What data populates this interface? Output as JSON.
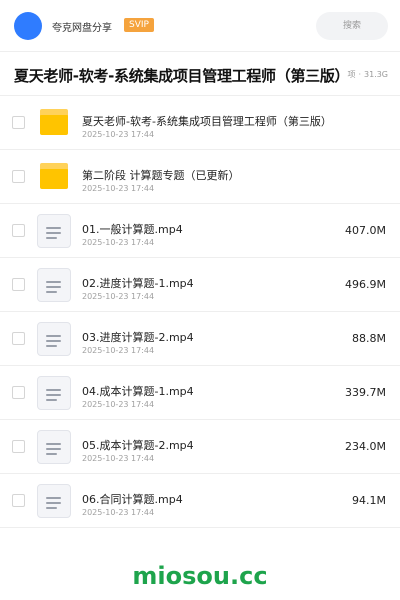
{
  "header": {
    "share_name": "夸克网盘分享",
    "badge": "SVIP",
    "search_placeholder": "搜索"
  },
  "title_row": {
    "title": "夏天老师-软考-系统集成项目管理工程师（第三版）",
    "meta_left": "项",
    "meta_size": "31.3G"
  },
  "items": [
    {
      "type": "folder",
      "name": "夏天老师-软考-系统集成项目管理工程师（第三版）",
      "date": "2025-10-23 17:44",
      "size": ""
    },
    {
      "type": "folder",
      "name": "第二阶段 计算题专题（已更新）",
      "date": "2025-10-23 17:44",
      "size": ""
    },
    {
      "type": "file",
      "name": "01.一般计算题.mp4",
      "date": "2025-10-23 17:44",
      "size": "407.0M"
    },
    {
      "type": "file",
      "name": "02.进度计算题-1.mp4",
      "date": "2025-10-23 17:44",
      "size": "496.9M"
    },
    {
      "type": "file",
      "name": "03.进度计算题-2.mp4",
      "date": "2025-10-23 17:44",
      "size": "88.8M"
    },
    {
      "type": "file",
      "name": "04.成本计算题-1.mp4",
      "date": "2025-10-23 17:44",
      "size": "339.7M"
    },
    {
      "type": "file",
      "name": "05.成本计算题-2.mp4",
      "date": "2025-10-23 17:44",
      "size": "234.0M"
    },
    {
      "type": "file",
      "name": "06.合同计算题.mp4",
      "date": "2025-10-23 17:44",
      "size": "94.1M"
    }
  ],
  "watermark": "miosou.cc",
  "colors": {
    "avatar": "#2f7cff",
    "badge": "#f5a33d",
    "folder": "#ffc400",
    "watermark": "#1ea44c"
  }
}
